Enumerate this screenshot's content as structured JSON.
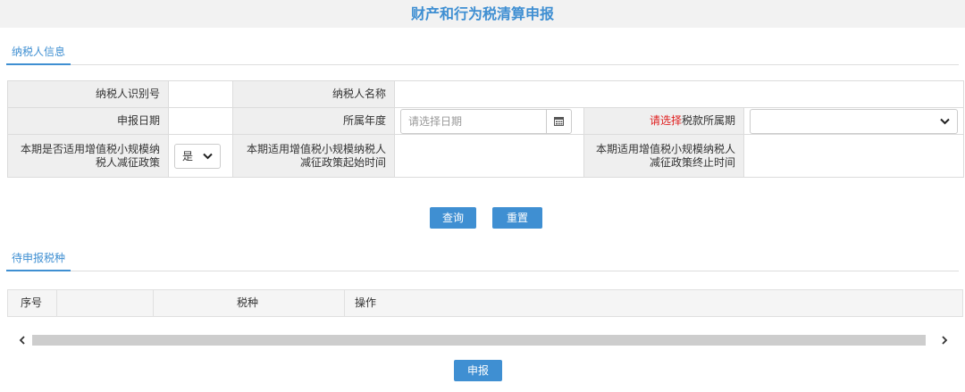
{
  "header": {
    "title": "财产和行为税清算申报"
  },
  "taxpayer_tab": {
    "label": "纳税人信息"
  },
  "form": {
    "taxpayer_id_label": "纳税人识别号",
    "taxpayer_id_value": "",
    "taxpayer_name_label": "纳税人名称",
    "taxpayer_name_value": "",
    "declare_date_label": "申报日期",
    "declare_date_value": "",
    "year_label": "所属年度",
    "year_placeholder": "请选择日期",
    "period_label_required": "请选择",
    "period_label_rest": "税款所属期",
    "period_value": "",
    "small_scale_label": "本期是否适用增值税小规模纳税人减征政策",
    "small_scale_value": "是",
    "policy_start_label": "本期适用增值税小规模纳税人减征政策起始时间",
    "policy_start_value": "",
    "policy_end_label": "本期适用增值税小规模纳税人减征政策终止时间",
    "policy_end_value": ""
  },
  "actions": {
    "query": "查询",
    "reset": "重置",
    "submit": "申报"
  },
  "pending_tab": {
    "label": "待申报税种"
  },
  "grid": {
    "columns": [
      "序号",
      "税种",
      "操作"
    ],
    "rows": []
  },
  "colors": {
    "accent": "#3f8fd2",
    "required": "#e02020",
    "label_bg": "#efefef"
  }
}
